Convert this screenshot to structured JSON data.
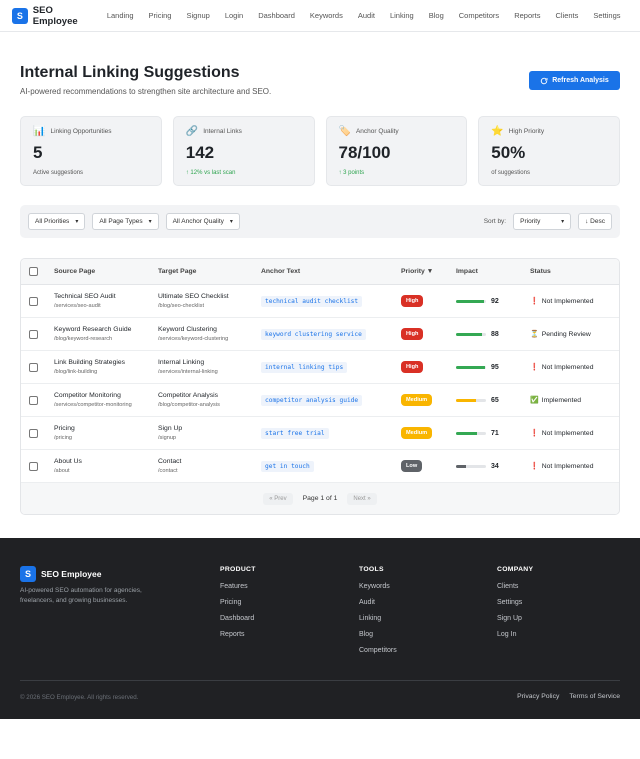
{
  "nav": {
    "brand_letter": "S",
    "brand": "SEO Employee",
    "links": [
      "Landing",
      "Pricing",
      "Signup",
      "Login",
      "Dashboard",
      "Keywords",
      "Audit",
      "Linking",
      "Blog",
      "Competitors",
      "Reports",
      "Clients",
      "Settings"
    ]
  },
  "header": {
    "title": "Internal Linking Suggestions",
    "subtitle": "AI-powered recommendations to strengthen site architecture and SEO.",
    "refresh_label": "Refresh Analysis"
  },
  "stats": [
    {
      "icon": "bar-chart-icon",
      "glyph": "📊",
      "label": "Linking Opportunities",
      "value": "5",
      "foot": "Active suggestions",
      "positive": false
    },
    {
      "icon": "link-icon",
      "glyph": "🔗",
      "label": "Internal Links",
      "value": "142",
      "foot": "↑ 12% vs last scan",
      "positive": true
    },
    {
      "icon": "tag-icon",
      "glyph": "🏷️",
      "label": "Anchor Quality",
      "value": "78/100",
      "foot": "↑ 3 points",
      "positive": true
    },
    {
      "icon": "star-icon",
      "glyph": "⭐",
      "label": "High Priority",
      "value": "50%",
      "foot": "of suggestions",
      "positive": false
    }
  ],
  "filters": {
    "priority": "All Priorities",
    "page_type": "All Page Types",
    "anchor_quality": "All Anchor Quality",
    "sort_label": "Sort by:",
    "sort_value": "Priority",
    "order": "↓ Desc"
  },
  "table": {
    "headers": {
      "source": "Source Page",
      "target": "Target Page",
      "anchor": "Anchor Text",
      "priority": "Priority ▼",
      "impact": "Impact",
      "status": "Status"
    },
    "rows": [
      {
        "src_title": "Technical SEO Audit",
        "src_path": "/services/seo-audit",
        "tgt_title": "Ultimate SEO Checklist",
        "tgt_path": "/blog/seo-checklist",
        "anchor": "technical audit checklist",
        "priority": "High",
        "impact": 92,
        "status_icon": "❗",
        "status": "Not Implemented"
      },
      {
        "src_title": "Keyword Research Guide",
        "src_path": "/blog/keyword-research",
        "tgt_title": "Keyword Clustering",
        "tgt_path": "/services/keyword-clustering",
        "anchor": "keyword clustering service",
        "priority": "High",
        "impact": 88,
        "status_icon": "⏳",
        "status": "Pending Review"
      },
      {
        "src_title": "Link Building Strategies",
        "src_path": "/blog/link-building",
        "tgt_title": "Internal Linking",
        "tgt_path": "/services/internal-linking",
        "anchor": "internal linking tips",
        "priority": "High",
        "impact": 95,
        "status_icon": "❗",
        "status": "Not Implemented"
      },
      {
        "src_title": "Competitor Monitoring",
        "src_path": "/services/competitor-monitoring",
        "tgt_title": "Competitor Analysis",
        "tgt_path": "/blog/competitor-analysis",
        "anchor": "competitor analysis guide",
        "priority": "Medium",
        "impact": 65,
        "status_icon": "✅",
        "status": "Implemented"
      },
      {
        "src_title": "Pricing",
        "src_path": "/pricing",
        "tgt_title": "Sign Up",
        "tgt_path": "/signup",
        "anchor": "start free trial",
        "priority": "Medium",
        "impact": 71,
        "status_icon": "❗",
        "status": "Not Implemented"
      },
      {
        "src_title": "About Us",
        "src_path": "/about",
        "tgt_title": "Contact",
        "tgt_path": "/contact",
        "anchor": "get in touch",
        "priority": "Low",
        "impact": 34,
        "status_icon": "❗",
        "status": "Not Implemented"
      }
    ],
    "pager": {
      "prev": "« Prev",
      "page": "Page 1 of 1",
      "next": "Next »"
    }
  },
  "colors": {
    "primary": "#1a73e8",
    "high": "#d93025",
    "medium": "#f9b500",
    "low": "#5f6368",
    "impact_high": "#34a853",
    "impact_med": "#f9b500",
    "impact_low": "#5f6368"
  },
  "footer": {
    "brand": "SEO Employee",
    "desc": "AI-powered SEO automation for agencies, freelancers, and growing businesses.",
    "columns": [
      {
        "title": "PRODUCT",
        "links": [
          "Features",
          "Pricing",
          "Dashboard",
          "Reports"
        ]
      },
      {
        "title": "TOOLS",
        "links": [
          "Keywords",
          "Audit",
          "Linking",
          "Blog",
          "Competitors"
        ]
      },
      {
        "title": "COMPANY",
        "links": [
          "Clients",
          "Settings",
          "Sign Up",
          "Log In"
        ]
      }
    ],
    "copyright": "© 2026 SEO Employee. All rights reserved.",
    "legal": [
      "Privacy Policy",
      "Terms of Service"
    ]
  }
}
